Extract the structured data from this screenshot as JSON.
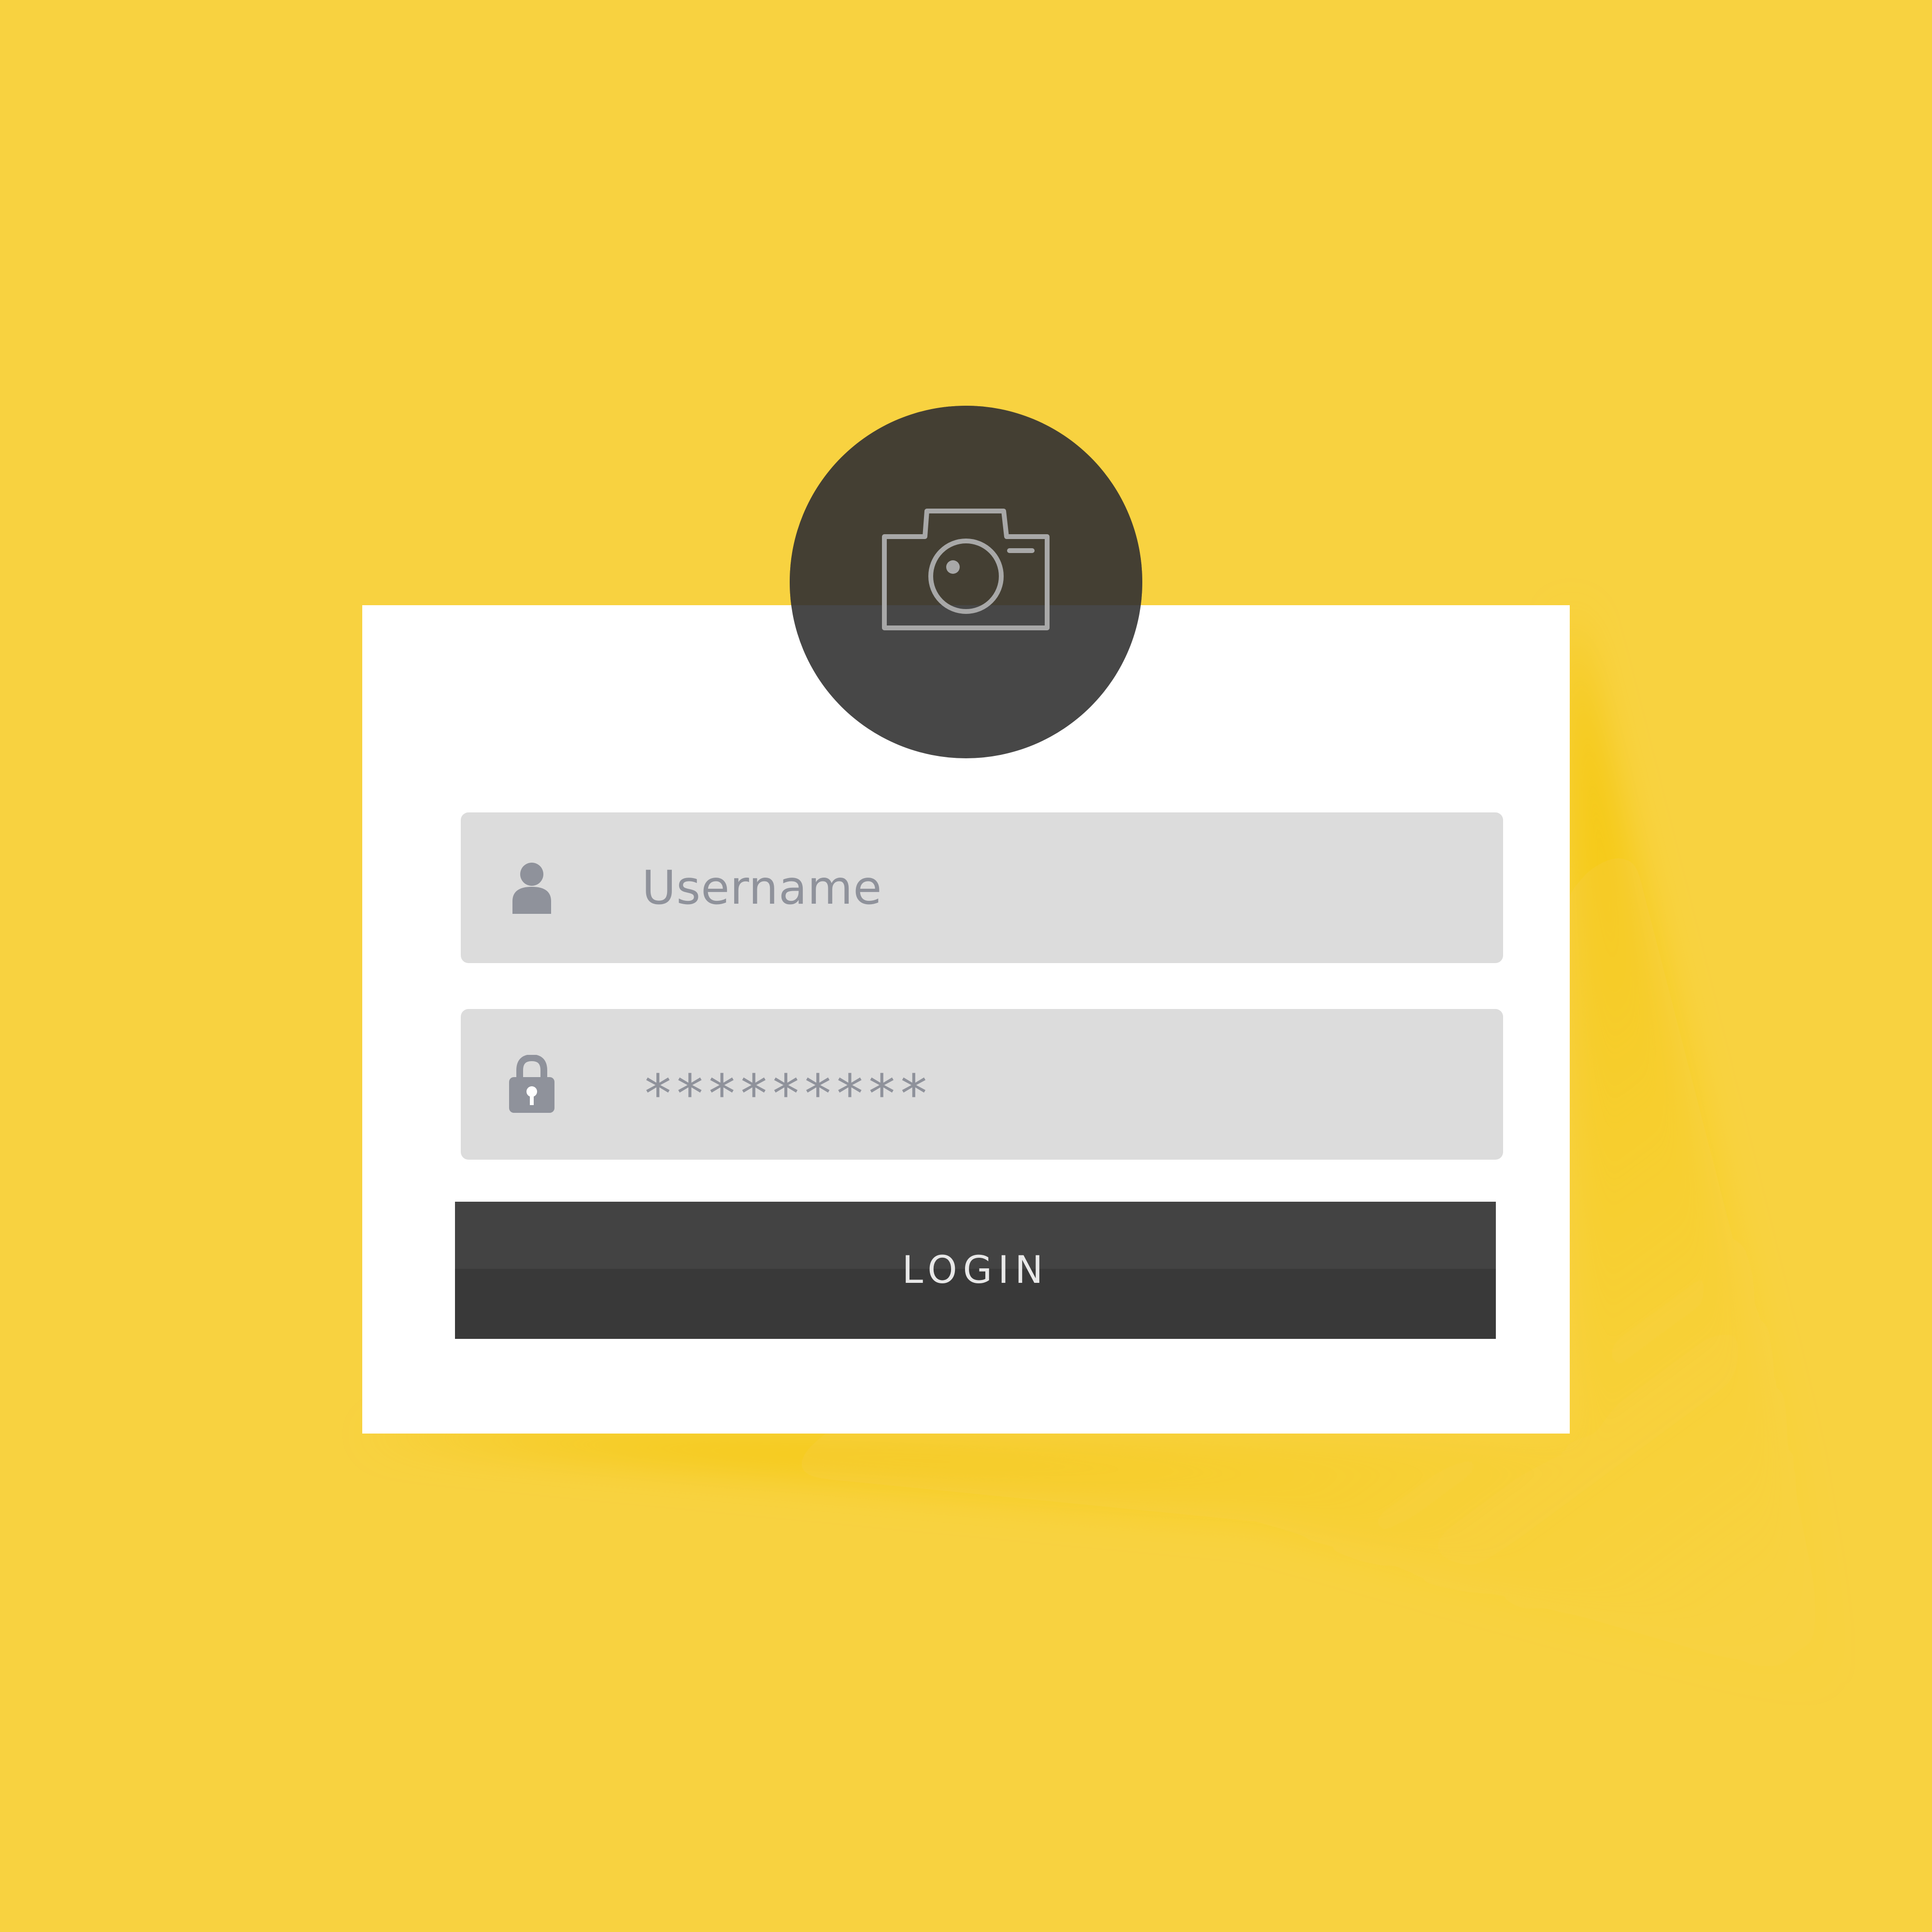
{
  "colors": {
    "background": "#f8d240",
    "card": "#ffffff",
    "field_background": "#dcdcdc",
    "field_text": "#8f929b",
    "button": "#3e3e3e",
    "button_text": "#e8e8e8",
    "avatar": "#474747"
  },
  "avatar": {
    "icon": "camera-icon"
  },
  "form": {
    "username": {
      "icon": "user-icon",
      "placeholder": "Username"
    },
    "password": {
      "icon": "lock-icon",
      "value": "*********"
    },
    "login_label": "LOGIN"
  }
}
